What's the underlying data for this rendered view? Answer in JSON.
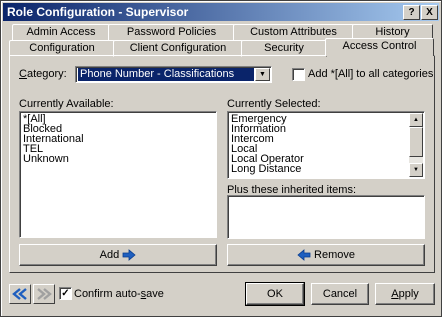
{
  "window": {
    "title": "Role Configuration - Supervisor",
    "help_glyph": "?",
    "close_glyph": "X"
  },
  "tabs_row1": [
    {
      "label": "Admin Access"
    },
    {
      "label": "Password Policies"
    },
    {
      "label": "Custom Attributes"
    },
    {
      "label": "History"
    }
  ],
  "tabs_row2": [
    {
      "label": "Configuration"
    },
    {
      "label": "Client Configuration"
    },
    {
      "label": "Security"
    },
    {
      "label": "Access Control",
      "active": true
    }
  ],
  "category": {
    "label": "Category:",
    "value": "Phone Number - Classifications"
  },
  "add_all_checkbox": {
    "label": "Add *[All] to all categories",
    "checked": false
  },
  "currently_available": {
    "label": "Currently Available:",
    "items": [
      "*[All]",
      "Blocked",
      "International",
      "TEL",
      "Unknown"
    ]
  },
  "currently_selected": {
    "label": "Currently Selected:",
    "items": [
      "Emergency",
      "Information",
      "Intercom",
      "Local",
      "Local Operator",
      "Long Distance"
    ]
  },
  "inherited": {
    "label": "Plus these inherited items:",
    "items": []
  },
  "buttons": {
    "add": "Add",
    "remove": "Remove",
    "ok": "OK",
    "cancel": "Cancel",
    "apply": "Apply"
  },
  "confirm_autosave": {
    "label": "Confirm auto-save",
    "checked": true
  },
  "icons": {
    "add_arrow": "right-arrow-icon",
    "remove_arrow": "left-arrow-icon",
    "nav_back": "double-left-arrow-icon",
    "nav_forward": "double-right-arrow-icon"
  },
  "colors": {
    "selection": "#0a246a",
    "arrow_blue": "#1f5fbf"
  }
}
